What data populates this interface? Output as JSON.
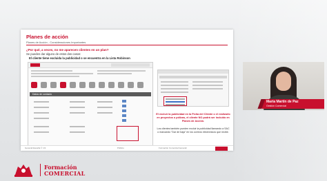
{
  "slide": {
    "title": "Planes de acción",
    "subtitle": "Planes de Acción - Consideraciones Importantes",
    "question": "¿Por qué, a veces, no me aparecen clientes en un plan?",
    "intro": "Se pueden dar alguno de estos dos casos:",
    "bullet": "El cliente tiene excluida la publicidad o se encuentra en la Lista Robinson",
    "crm_section": "Datos de contacto",
    "note": "El excluir la publicidad en la Ficha del Cliente o el realizarlo en proyectos o pólizas, el cliente NO podrá ser incluido en Planes de Acción.",
    "note2": "Los clientes también pueden excluir la publicidad llamando a SAC o marcando \"Dar de baja\" en los correos electrónicos que recibe.",
    "footer_left": "Generali España © 1/1",
    "footer_center": "Público",
    "footer_right": "Formación Comercial Generali"
  },
  "presenter": {
    "name": "María Martín de Paz",
    "role": "Gestión Comercial"
  },
  "brand": {
    "line1": "Formación",
    "line2": "COMERCIAL",
    "accent": "#c8102e"
  }
}
